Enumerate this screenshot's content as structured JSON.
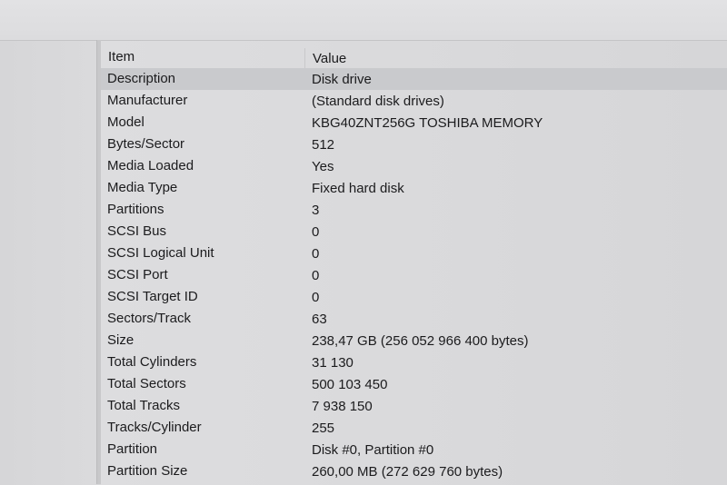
{
  "table": {
    "columns": {
      "item": "Item",
      "value": "Value"
    },
    "rows": [
      {
        "item": "Description",
        "value": "Disk drive"
      },
      {
        "item": "Manufacturer",
        "value": "(Standard disk drives)"
      },
      {
        "item": "Model",
        "value": "KBG40ZNT256G TOSHIBA MEMORY"
      },
      {
        "item": "Bytes/Sector",
        "value": "512"
      },
      {
        "item": "Media Loaded",
        "value": "Yes"
      },
      {
        "item": "Media Type",
        "value": "Fixed hard disk"
      },
      {
        "item": "Partitions",
        "value": "3"
      },
      {
        "item": "SCSI Bus",
        "value": "0"
      },
      {
        "item": "SCSI Logical Unit",
        "value": "0"
      },
      {
        "item": "SCSI Port",
        "value": "0"
      },
      {
        "item": "SCSI Target ID",
        "value": "0"
      },
      {
        "item": "Sectors/Track",
        "value": "63"
      },
      {
        "item": "Size",
        "value": "238,47 GB (256 052 966 400 bytes)"
      },
      {
        "item": "Total Cylinders",
        "value": "31 130"
      },
      {
        "item": "Total Sectors",
        "value": "500 103 450"
      },
      {
        "item": "Total Tracks",
        "value": "7 938 150"
      },
      {
        "item": "Tracks/Cylinder",
        "value": "255"
      },
      {
        "item": "Partition",
        "value": "Disk #0, Partition #0"
      },
      {
        "item": "Partition Size",
        "value": "260,00 MB (272 629 760 bytes)"
      }
    ]
  }
}
